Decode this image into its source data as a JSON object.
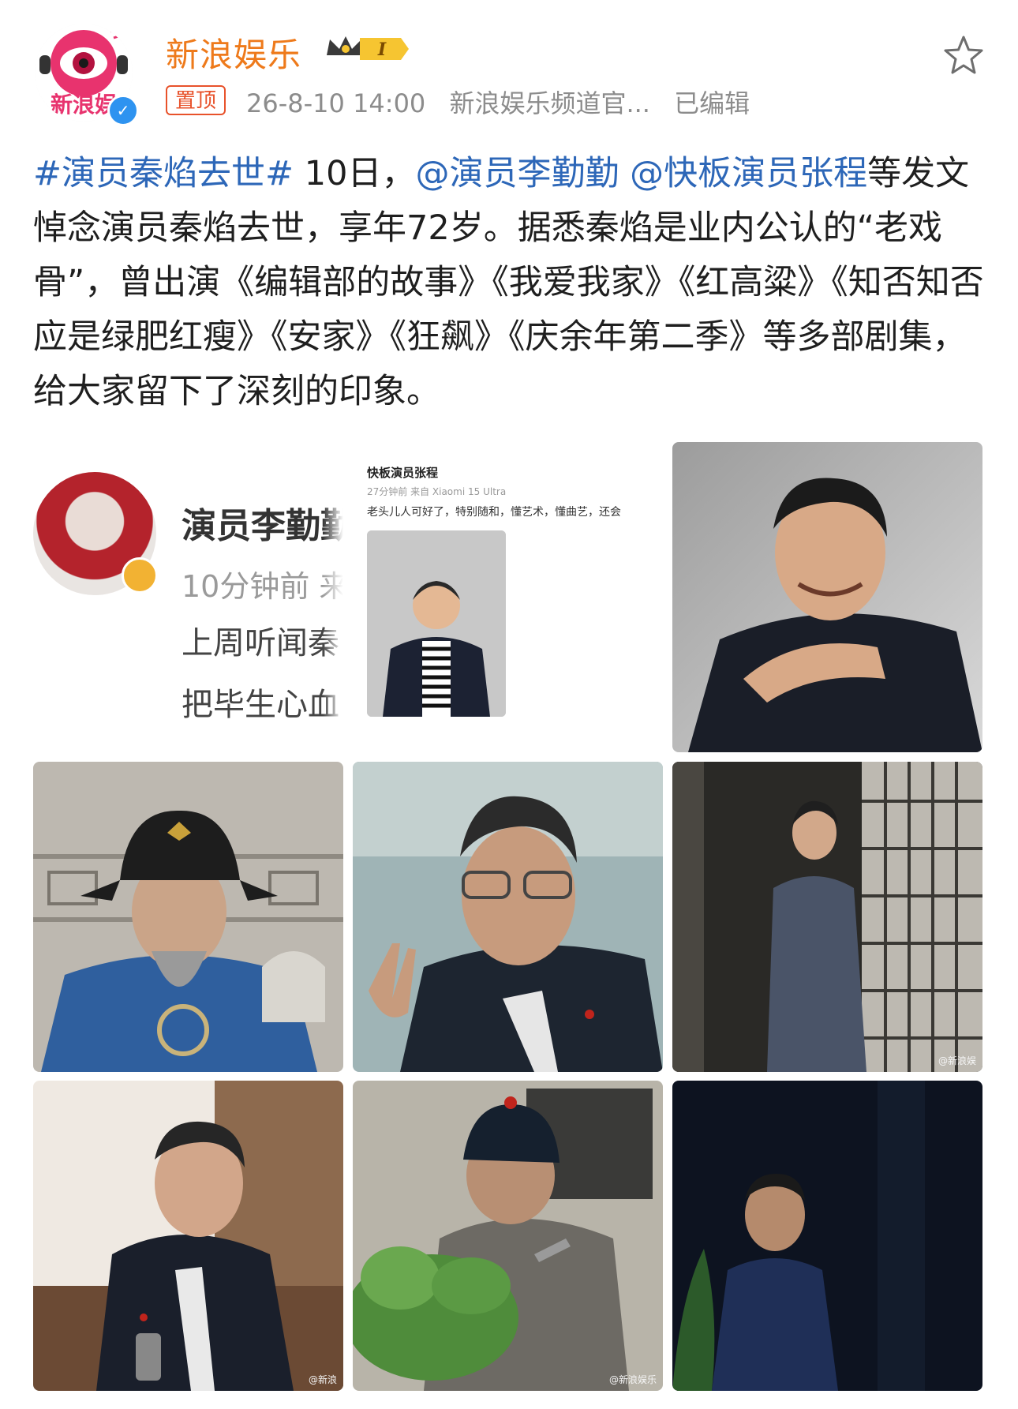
{
  "header": {
    "author": "新浪娱乐",
    "avatar_text": "新浪娱",
    "pin_label": "置顶",
    "timestamp": "26-8-10 14:00",
    "source": "新浪娱乐频道官...",
    "edited": "已编辑",
    "vip_level": "I"
  },
  "post": {
    "hashtag": "#演员秦焰去世#",
    "text_1": " 10日，",
    "mention_1": "@演员李勤勤",
    "mention_2": "@快板演员张程",
    "text_2": "等发文悼念演员秦焰去世，享年72岁。据悉秦焰是业内公认的“老戏骨”，曾出演《编辑部的故事》《我爱我家》《红高粱》《知否知否应是绿肥红瘦》《安家》《狂飙》《庆余年第二季》等多部剧集，给大家留下了深刻的印象。"
  },
  "images": {
    "shot1": {
      "name": "演员李勤勤",
      "time": "10分钟前  来",
      "line1": "上周听闻秦",
      "line2": "把毕生心血"
    },
    "shot2": {
      "name": "快板演员张程",
      "time": "27分钟前  来自 Xiaomi 15 Ultra",
      "line1": "老头儿人可好了，特别随和，懂艺术，懂曲艺，还会"
    },
    "watermark_5": "",
    "watermark_6": "@新浪娱",
    "watermark_7": "@新浪",
    "watermark_8": "@新浪娱乐"
  },
  "colors": {
    "author": "#ee7a1b",
    "link": "#2d67b8",
    "pin": "#e8522b",
    "meta": "#8c8c8c"
  }
}
